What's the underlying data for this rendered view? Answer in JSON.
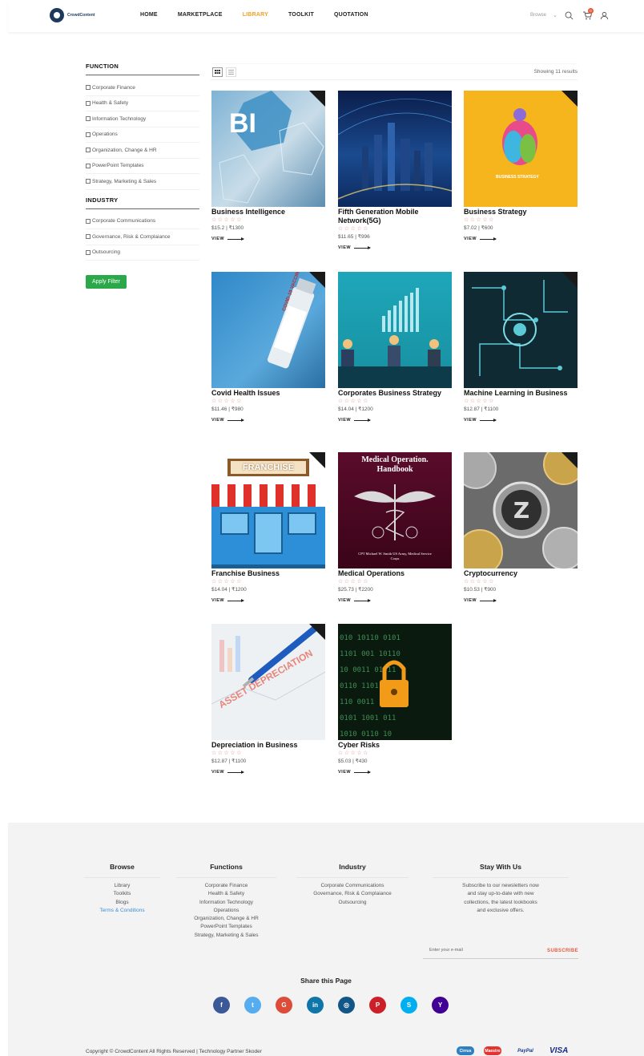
{
  "header": {
    "logo_text": "CrowdContent",
    "nav": [
      "HOME",
      "MARKETPLACE",
      "LIBRARY",
      "TOOLKIT",
      "QUOTATION"
    ],
    "active_nav": "LIBRARY",
    "browse_label": "Browse",
    "cart_count": "0"
  },
  "sidebar": {
    "function_title": "FUNCTION",
    "functions": [
      "Corporate Finance",
      "Health & Safety",
      "Information Technology",
      "Operations",
      "Organization, Change & HR",
      "PowerPoint Templates",
      "Strategy, Marketing & Sales"
    ],
    "industry_title": "INDUSTRY",
    "industries": [
      "Corporate Communications",
      "Governance, Risk & Complaiance",
      "Outsourcing"
    ],
    "apply_label": "Apply Filter"
  },
  "toolbar": {
    "results_text": "Showing 11 results"
  },
  "products": [
    {
      "title": "Business Intelligence",
      "price": "$15.2 | ₹1300",
      "view": "VIEW",
      "thumb_text": "BI"
    },
    {
      "title": "Fifth Generation Mobile Network(5G)",
      "price": "$11.65 | ₹996",
      "view": "VIEW"
    },
    {
      "title": "Business Strategy",
      "price": "$7.02 | ₹600",
      "view": "VIEW",
      "thumb_text": "BUSINESS STRATEGY"
    },
    {
      "title": "Covid Health Issues",
      "price": "$11.46 | ₹980",
      "view": "VIEW",
      "thumb_text": "COVID-19 VACCINE"
    },
    {
      "title": "Corporates Business Strategy",
      "price": "$14.04 | ₹1200",
      "view": "VIEW"
    },
    {
      "title": "Machine Learning in Business",
      "price": "$12.87 | ₹1100",
      "view": "VIEW"
    },
    {
      "title": "Franchise Business",
      "price": "$14.04 | ₹1200",
      "view": "VIEW",
      "thumb_text": "FRANCHISE"
    },
    {
      "title": "Medical Operations",
      "price": "$25.73 | ₹2200",
      "view": "VIEW",
      "thumb_text": "Medical Operation. Handbook",
      "thumb_sub": "CPT Michael W. Smith US Army, Medical Service Corps"
    },
    {
      "title": "Cryptocurrency",
      "price": "$10.53 | ₹900",
      "view": "VIEW"
    },
    {
      "title": "Depreciation in Business",
      "price": "$12.87 | ₹1100",
      "view": "VIEW",
      "thumb_text": "ASSET DEPRECIATION"
    },
    {
      "title": "Cyber Risks",
      "price": "$5.03 | ₹430",
      "view": "VIEW"
    }
  ],
  "stars_empty": "☆☆☆☆☆",
  "footer": {
    "browse": {
      "title": "Browse",
      "links": [
        "Library",
        "Toolkits",
        "Blogs",
        "Terms & Conditions"
      ]
    },
    "functions": {
      "title": "Functions",
      "links": [
        "Corporate Finance",
        "Health & Safety",
        "Information Technology",
        "Operations",
        "Organization, Change & HR",
        "PowerPoint Templates",
        "Strategy, Marketing & Sales"
      ]
    },
    "industry": {
      "title": "Industry",
      "links": [
        "Corporate Communications",
        "Governance, Risk & Complaiance",
        "Outsourcing"
      ]
    },
    "stay": {
      "title": "Stay With Us",
      "text_lines": [
        "Subscribe to our newsletters now",
        "and stay up-to-date with new",
        "collections, the latest lookbooks",
        "and exclusive offers."
      ]
    },
    "email_placeholder": "Enter your e-mail",
    "subscribe_label": "SUBSCRIBE",
    "share_title": "Share this Page",
    "social": [
      {
        "name": "facebook",
        "glyph": "f",
        "color": "#3b5998"
      },
      {
        "name": "twitter",
        "glyph": "t",
        "color": "#55acee"
      },
      {
        "name": "google",
        "glyph": "G",
        "color": "#dd4b39"
      },
      {
        "name": "linkedin",
        "glyph": "in",
        "color": "#0e76a8"
      },
      {
        "name": "instagram",
        "glyph": "◎",
        "color": "#125688"
      },
      {
        "name": "pinterest",
        "glyph": "P",
        "color": "#cb2027"
      },
      {
        "name": "skype",
        "glyph": "S",
        "color": "#00aff0"
      },
      {
        "name": "yahoo",
        "glyph": "Y",
        "color": "#410093"
      }
    ],
    "copyright": "Copyright © CrowdContent All Rights Reserved | Technology Partner Skoder",
    "payments": [
      "Cirrus",
      "Maestro",
      "PayPal",
      "VISA"
    ]
  }
}
